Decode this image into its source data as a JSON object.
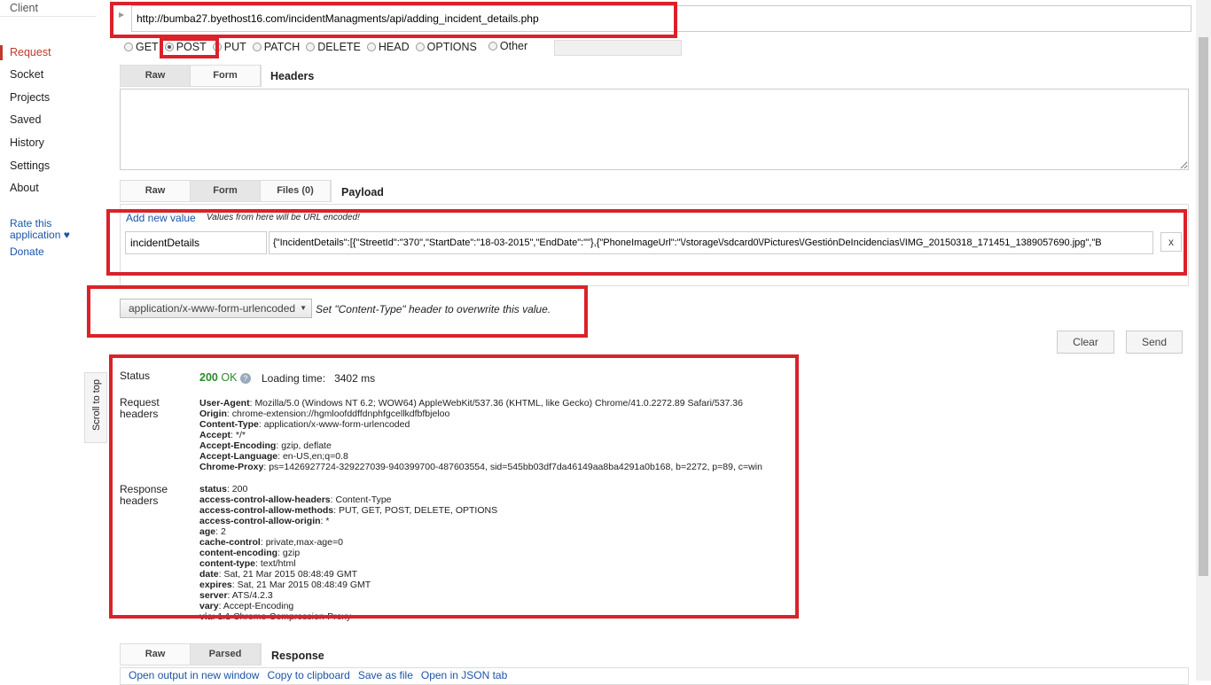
{
  "sidebar": {
    "title": "Client",
    "items": [
      {
        "label": "Request",
        "active": true
      },
      {
        "label": "Socket"
      },
      {
        "label": "Projects"
      },
      {
        "label": "Saved"
      },
      {
        "label": "History"
      },
      {
        "label": "Settings"
      },
      {
        "label": "About"
      }
    ],
    "rate": "Rate this application ♥",
    "donate": "Donate"
  },
  "request": {
    "url": "http://bumba27.byethost16.com/incidentManagments/api/adding_incident_details.php",
    "methods": [
      "GET",
      "POST",
      "PUT",
      "PATCH",
      "DELETE",
      "HEAD",
      "OPTIONS",
      "Other"
    ],
    "selected_method": "POST",
    "header_tabs": [
      "Raw",
      "Form"
    ],
    "headers_label": "Headers",
    "headers_value": "",
    "payload_tabs": [
      "Raw",
      "Form",
      "Files (0)"
    ],
    "payload_label": "Payload",
    "add_new_value": "Add new value",
    "encoded_note": "Values from here will be URL encoded!",
    "param_key": "incidentDetails",
    "param_value": "{\"IncidentDetails\":[{\"StreetId\":\"370\",\"StartDate\":\"18-03-2015\",\"EndDate\":\"\"},{\"PhoneImageUrl\":\"\\/storage\\/sdcard0\\/Pictures\\/GestiónDeIncidencias\\/IMG_20150318_171451_1389057690.jpg\",\"B",
    "remove": "x",
    "content_type": "application/x-www-form-urlencoded",
    "content_type_note": "Set \"Content-Type\" header to overwrite this value.",
    "clear": "Clear",
    "send": "Send"
  },
  "scroll_top": "Scroll to top",
  "result": {
    "status_label": "Status",
    "status_code": "200",
    "status_text": "OK",
    "loading_label": "Loading time:",
    "loading_value": "3402 ms",
    "req_headers_label": "Request headers",
    "req_headers": [
      [
        "User-Agent",
        "Mozilla/5.0 (Windows NT 6.2; WOW64) AppleWebKit/537.36 (KHTML, like Gecko) Chrome/41.0.2272.89 Safari/537.36"
      ],
      [
        "Origin",
        "chrome-extension://hgmloofddffdnphfgcellkdfbfbjeloo"
      ],
      [
        "Content-Type",
        "application/x-www-form-urlencoded"
      ],
      [
        "Accept",
        "*/*"
      ],
      [
        "Accept-Encoding",
        "gzip, deflate"
      ],
      [
        "Accept-Language",
        "en-US,en;q=0.8"
      ],
      [
        "Chrome-Proxy",
        "ps=1426927724-329227039-940399700-487603554, sid=545bb03df7da46149aa8ba4291a0b168, b=2272, p=89, c=win"
      ]
    ],
    "res_headers_label": "Response headers",
    "res_headers": [
      [
        "status",
        "200"
      ],
      [
        "access-control-allow-headers",
        "Content-Type"
      ],
      [
        "access-control-allow-methods",
        "PUT, GET, POST, DELETE, OPTIONS"
      ],
      [
        "access-control-allow-origin",
        "*"
      ],
      [
        "age",
        "2"
      ],
      [
        "cache-control",
        "private,max-age=0"
      ],
      [
        "content-encoding",
        "gzip"
      ],
      [
        "content-type",
        "text/html"
      ],
      [
        "date",
        "Sat, 21 Mar 2015 08:48:49 GMT"
      ],
      [
        "expires",
        "Sat, 21 Mar 2015 08:48:49 GMT"
      ],
      [
        "server",
        "ATS/4.2.3"
      ],
      [
        "vary",
        "Accept-Encoding"
      ],
      [
        "via",
        "1.1 Chrome-Compression-Proxy"
      ]
    ]
  },
  "response": {
    "tabs": [
      "Raw",
      "Parsed"
    ],
    "label": "Response",
    "links": [
      "Open output in new window",
      "Copy to clipboard",
      "Save as file",
      "Open in JSON tab"
    ]
  },
  "colors": {
    "highlight": "#d9222a",
    "active": "#c0392b",
    "link": "#1a55a8",
    "ok": "#2a8a2a"
  }
}
